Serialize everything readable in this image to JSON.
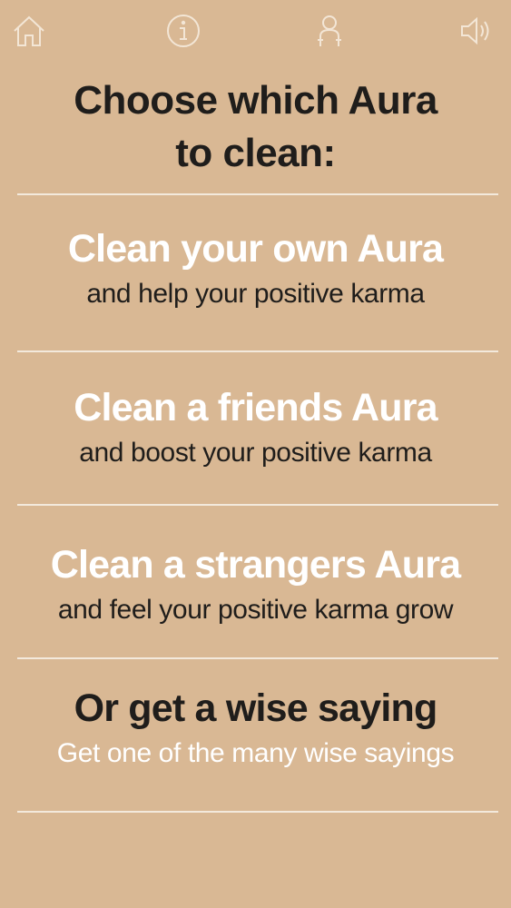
{
  "toolbar": {
    "home_icon": "home-icon",
    "info_icon": "info-icon",
    "profile_icon": "person-icon",
    "sound_icon": "speaker-icon"
  },
  "title": {
    "line1": "Choose which Aura",
    "line2": "to clean:"
  },
  "options": [
    {
      "heading": "Clean your own Aura",
      "subtext": "and help your positive karma"
    },
    {
      "heading": "Clean a friends Aura",
      "subtext": "and boost your positive karma"
    },
    {
      "heading": "Clean a strangers Aura",
      "subtext": "and feel your positive karma grow"
    },
    {
      "heading": "Or get a wise saying",
      "subtext": "Get one of the many wise sayings"
    }
  ],
  "colors": {
    "background": "#d9b894",
    "light_text": "#ffffff",
    "dark_text": "#1f1d1b",
    "icon_stroke": "#f3e6d6"
  }
}
